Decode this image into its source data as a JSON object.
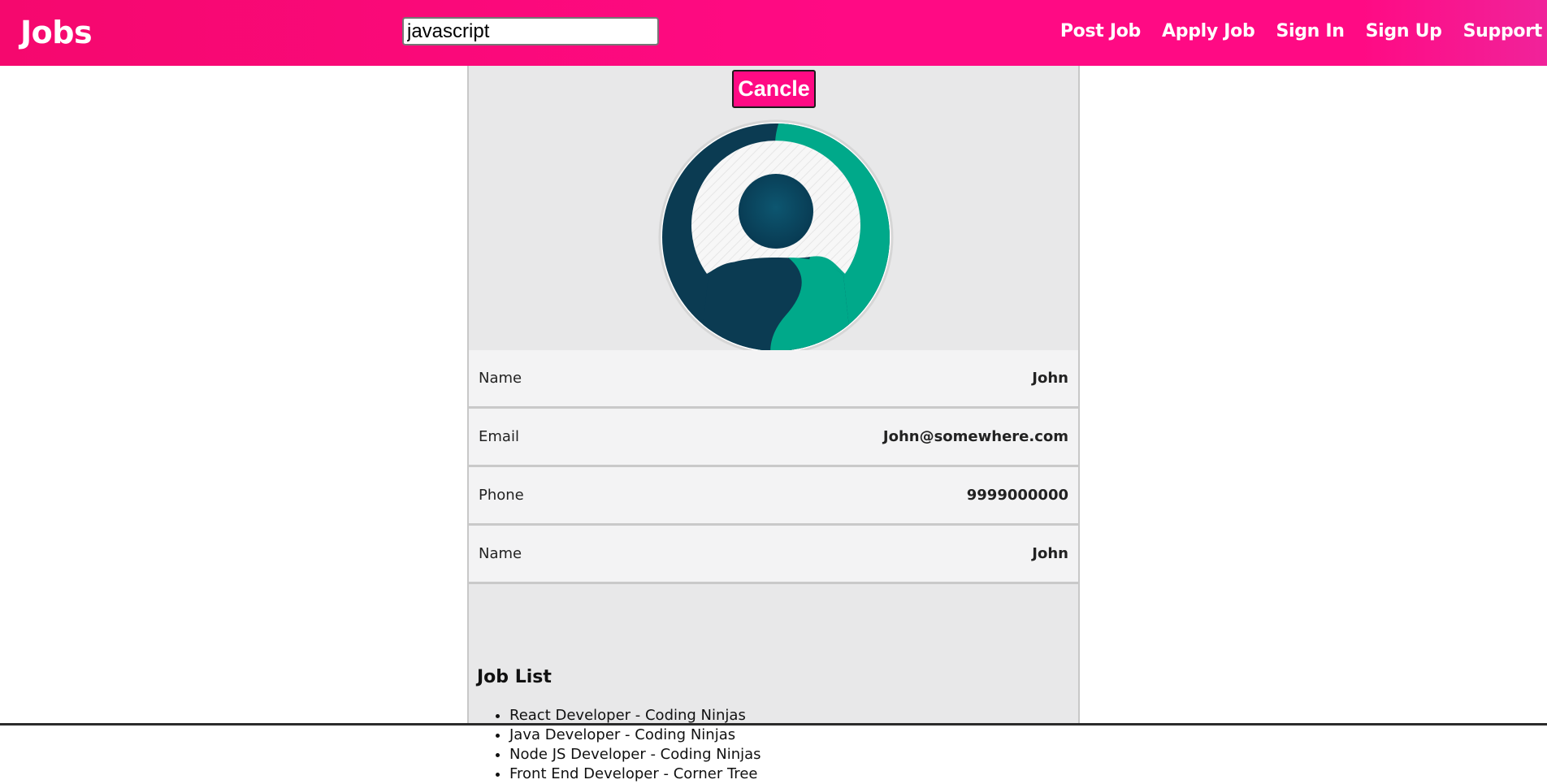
{
  "header": {
    "brand": "Jobs",
    "search_value": "javascript",
    "nav": [
      "Post Job",
      "Apply Job",
      "Sign In",
      "Sign Up",
      "Support"
    ]
  },
  "profile": {
    "cancel_label": "Cancle",
    "avatar_icon": "user-avatar-icon",
    "rows": [
      {
        "label": "Name",
        "value": "John"
      },
      {
        "label": "Email",
        "value": "John@somewhere.com"
      },
      {
        "label": "Phone",
        "value": "9999000000"
      },
      {
        "label": "Name",
        "value": "John"
      }
    ]
  },
  "job_list": {
    "title": "Job List",
    "items": [
      "React Developer - Coding Ninjas",
      "Java Developer - Coding Ninjas",
      "Node JS Developer - Coding Ninjas",
      "Front End Developer - Corner Tree"
    ]
  },
  "colors": {
    "header_pink": "#ff0a84",
    "card_bg": "#e8e8e9",
    "avatar_dark": "#0b3b52",
    "avatar_teal": "#00a98a"
  }
}
